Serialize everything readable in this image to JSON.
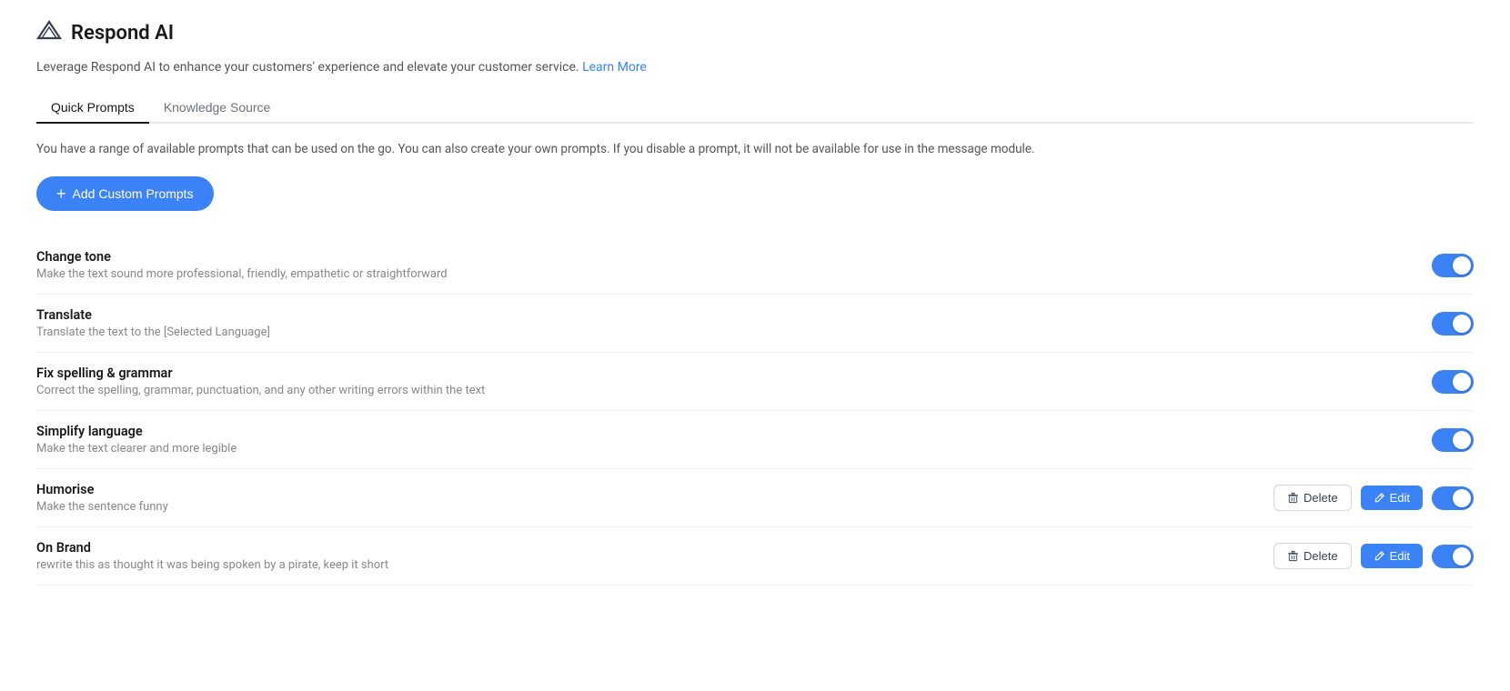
{
  "header": {
    "title": "Respond AI",
    "logo_icon": "mountain-icon"
  },
  "subtitle": {
    "text": "Leverage Respond AI to enhance your customers' experience and elevate your customer service.",
    "link_text": "Learn More",
    "link_href": "#"
  },
  "tabs": [
    {
      "id": "quick-prompts",
      "label": "Quick Prompts",
      "active": true
    },
    {
      "id": "knowledge-source",
      "label": "Knowledge Source",
      "active": false
    }
  ],
  "description": "You have a range of available prompts that can be used on the go. You can also create your own prompts. If you disable a prompt, it will not be available for use in the message module.",
  "add_button_label": "Add Custom Prompts",
  "prompts": [
    {
      "id": "change-tone",
      "name": "Change tone",
      "description": "Make the text sound more professional, friendly, empathetic or straightforward",
      "enabled": true,
      "has_actions": false
    },
    {
      "id": "translate",
      "name": "Translate",
      "description": "Translate the text to the [Selected Language]",
      "enabled": true,
      "has_actions": false
    },
    {
      "id": "fix-spelling-grammar",
      "name": "Fix spelling & grammar",
      "description": "Correct the spelling, grammar, punctuation, and any other writing errors within the text",
      "enabled": true,
      "has_actions": false
    },
    {
      "id": "simplify-language",
      "name": "Simplify language",
      "description": "Make the text clearer and more legible",
      "enabled": true,
      "has_actions": false
    },
    {
      "id": "humorise",
      "name": "Humorise",
      "description": "Make the sentence funny",
      "enabled": true,
      "has_actions": true,
      "delete_label": "Delete",
      "edit_label": "Edit"
    },
    {
      "id": "on-brand",
      "name": "On Brand",
      "description": "rewrite this as thought it was being spoken by a pirate, keep it short",
      "enabled": true,
      "has_actions": true,
      "delete_label": "Delete",
      "edit_label": "Edit"
    }
  ],
  "colors": {
    "accent": "#3b82f6",
    "toggle_on": "#3b82f6",
    "toggle_off": "#d1d5db"
  }
}
